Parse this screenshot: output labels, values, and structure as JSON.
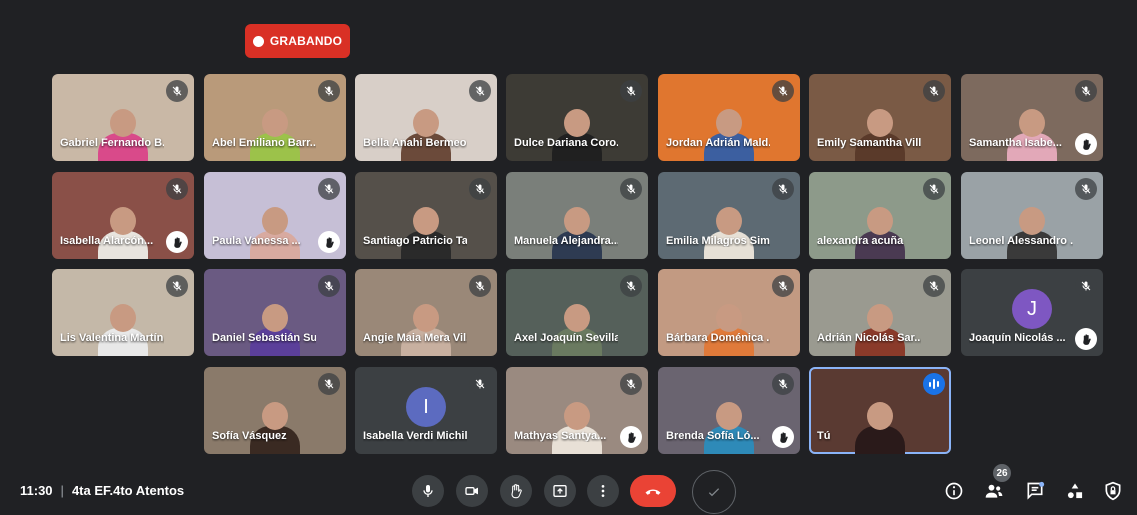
{
  "recording": {
    "label": "GRABANDO"
  },
  "meeting": {
    "time": "11:30",
    "separator": "|",
    "name": "4ta EF.4to Atentos"
  },
  "participants_badge": "26",
  "participants": [
    {
      "name": "Gabriel Fernando B...",
      "muted": true,
      "hand": false,
      "bg": "#c9b8a6",
      "tone": "#d94a8a"
    },
    {
      "name": "Abel Emiliano Barr...",
      "muted": true,
      "hand": false,
      "bg": "#b99a7a",
      "tone": "#9cc24a"
    },
    {
      "name": "Bella Anahi Bermeo ...",
      "muted": true,
      "hand": false,
      "bg": "#d8cfc8",
      "tone": "#6b4a3a"
    },
    {
      "name": "Dulce Dariana Coro...",
      "muted": true,
      "hand": false,
      "bg": "#3d3b35",
      "tone": "#202020"
    },
    {
      "name": "Jordan Adrián Mald...",
      "muted": true,
      "hand": false,
      "bg": "#e0762f",
      "tone": "#3c5fa0"
    },
    {
      "name": "Emily Samantha Vill...",
      "muted": true,
      "hand": false,
      "bg": "#7a5a45",
      "tone": "#5a3a2a"
    },
    {
      "name": "Samantha Isabe...",
      "muted": true,
      "hand": true,
      "bg": "#7d6a5e",
      "tone": "#e2a8b8"
    },
    {
      "name": "Isabella Alarcón...",
      "muted": true,
      "hand": true,
      "bg": "#8a5048",
      "tone": "#e8e4de"
    },
    {
      "name": "Paula Vanessa ...",
      "muted": true,
      "hand": true,
      "bg": "#c6bfd6",
      "tone": "#d8aaa0"
    },
    {
      "name": "Santiago Patricio Ta...",
      "muted": true,
      "hand": false,
      "bg": "#55504a",
      "tone": "#2a2a2a"
    },
    {
      "name": "Manuela Alejandra...",
      "muted": true,
      "hand": false,
      "bg": "#7a7f7a",
      "tone": "#2e3b52"
    },
    {
      "name": "Emilia Milagros Sim...",
      "muted": true,
      "hand": false,
      "bg": "#5d6a73",
      "tone": "#e6e0d6"
    },
    {
      "name": "alexandra acuña",
      "muted": true,
      "hand": false,
      "bg": "#8d9a8a",
      "tone": "#4a3a52"
    },
    {
      "name": "Leonel Alessandro ...",
      "muted": true,
      "hand": false,
      "bg": "#9aa2a6",
      "tone": "#3a3a3a"
    },
    {
      "name": "Lis Valentina Martín...",
      "muted": true,
      "hand": false,
      "bg": "#c4b8a8",
      "tone": "#e8e8e8"
    },
    {
      "name": "Daniel Sebastián Su...",
      "muted": true,
      "hand": false,
      "bg": "#6a5a82",
      "tone": "#5b3f9a"
    },
    {
      "name": "Angie Maia Mera Vil...",
      "muted": true,
      "hand": false,
      "bg": "#9a8878",
      "tone": "#c8b0a0"
    },
    {
      "name": "Axel Joaquín Sevilla...",
      "muted": true,
      "hand": false,
      "bg": "#55605a",
      "tone": "#6a7a60"
    },
    {
      "name": "Bárbara Doménica ...",
      "muted": true,
      "hand": false,
      "bg": "#c29a82",
      "tone": "#e07a3a"
    },
    {
      "name": "Adrián Nicolás Sar...",
      "muted": true,
      "hand": false,
      "bg": "#9a9a90",
      "tone": "#8a3a2a"
    },
    {
      "name": "Joaquín Nicolás ...",
      "muted": true,
      "hand": true,
      "bg": "#3c4043",
      "avatar": "J",
      "avatar_color": "#7e57c2"
    },
    {
      "name": "Sofía Vásquez",
      "muted": true,
      "hand": false,
      "bg": "#8a7a6a",
      "tone": "#3a2a22"
    },
    {
      "name": "Isabella Verdi Michil...",
      "muted": true,
      "hand": false,
      "bg": "#3c4043",
      "avatar": "I",
      "avatar_color": "#5c6bc0"
    },
    {
      "name": "Mathyas Santya...",
      "muted": true,
      "hand": true,
      "bg": "#9a8a80",
      "tone": "#e8e0d6"
    },
    {
      "name": "Brenda Sofía Ló...",
      "muted": true,
      "hand": true,
      "bg": "#6a6470",
      "tone": "#2e8ab8"
    },
    {
      "name": "Tú",
      "muted": false,
      "hand": false,
      "speaking": true,
      "bg": "#5a3a32",
      "tone": "#2a1a1a",
      "self": true
    }
  ]
}
